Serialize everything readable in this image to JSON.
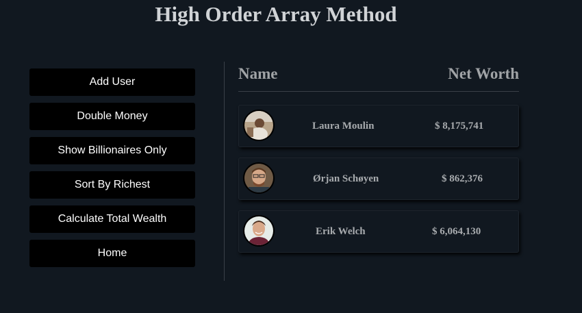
{
  "page": {
    "title": "High Order Array Method"
  },
  "sidebar": {
    "buttons": [
      {
        "label": "Add User"
      },
      {
        "label": "Double Money"
      },
      {
        "label": "Show Billionaires Only"
      },
      {
        "label": "Sort By Richest"
      },
      {
        "label": "Calculate Total Wealth"
      },
      {
        "label": "Home"
      }
    ]
  },
  "table": {
    "headers": {
      "name": "Name",
      "net_worth": "Net Worth"
    },
    "users": [
      {
        "name": "Laura Moulin",
        "net_worth": "$ 8,175,741",
        "avatar": "user-photo"
      },
      {
        "name": "Ørjan Schøyen",
        "net_worth": "$ 862,376",
        "avatar": "user-photo"
      },
      {
        "name": "Erik Welch",
        "net_worth": "$ 6,064,130",
        "avatar": "user-photo"
      }
    ]
  },
  "colors": {
    "background": "#111820",
    "button_bg": "#000000",
    "button_text": "#ffffff",
    "title_text": "#d0d3d6",
    "muted_text": "#a0a3a6"
  }
}
